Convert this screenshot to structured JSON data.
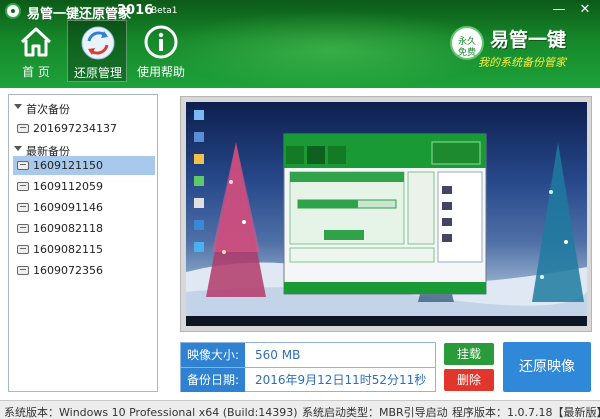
{
  "window": {
    "title": "易管一键还原管家",
    "year": "2016",
    "beta": "Beta1",
    "minimize": "—",
    "close": "✕"
  },
  "nav": {
    "home": "首 页",
    "restore_manage": "还原管理",
    "help": "使用帮助"
  },
  "brand": {
    "badge_top": "永久",
    "badge_bottom": "免费",
    "name": "易管一键",
    "slogan": "我的系统备份管家"
  },
  "sidebar": {
    "groups": [
      {
        "label": "首次备份",
        "items": [
          "201697234137"
        ]
      },
      {
        "label": "最新备份",
        "items": [
          "1609121150",
          "1609112059",
          "1609091146",
          "1609082118",
          "1609082115",
          "1609072356"
        ]
      }
    ],
    "selected": "1609121150"
  },
  "info": {
    "size_label": "映像大小:",
    "size_value": "560 MB",
    "date_label": "备份日期:",
    "date_value": "2016年9月12日11时52分11秒"
  },
  "buttons": {
    "mount": "挂载",
    "delete": "删除",
    "restore": "还原映像"
  },
  "status": {
    "os": "系统版本：Windows 10 Professional x64 (Build:14393)",
    "boot": "系统启动类型：MBR引导启动",
    "version": "程序版本：1.0.7.18【最新版】"
  },
  "colors": {
    "header_green": "#1a9a34",
    "accent_blue": "#2f82d2",
    "mount_green": "#2a9a3a",
    "delete_red": "#e0362c",
    "slogan_yellow": "#ffeb3b",
    "selection": "#a8c8ec"
  }
}
